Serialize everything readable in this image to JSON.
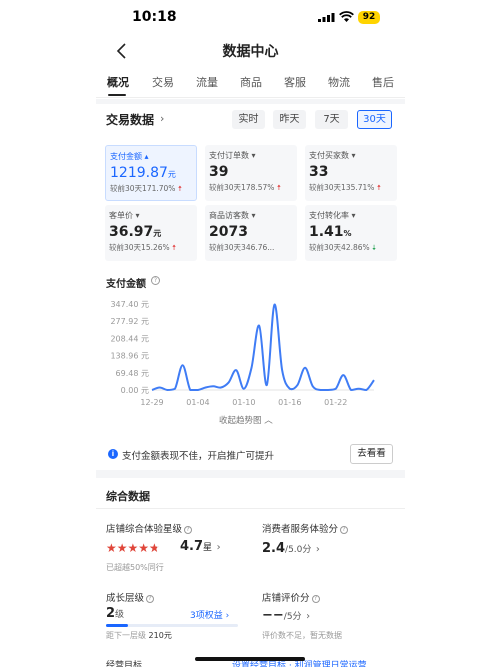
{
  "status": {
    "time": "10:18",
    "battery": "92"
  },
  "nav": {
    "title": "数据中心"
  },
  "tabs": [
    "概况",
    "交易",
    "流量",
    "商品",
    "客服",
    "物流",
    "售后"
  ],
  "trade": {
    "title": "交易数据",
    "ranges": [
      "实时",
      "昨天",
      "7天",
      "30天"
    ],
    "active_range": "30天",
    "cards": [
      {
        "label": "支付金额",
        "value": "1219.87",
        "unit": "元",
        "compare": "较前30天171.70%",
        "trend": "up"
      },
      {
        "label": "支付订单数",
        "value": "39",
        "unit": "",
        "compare": "较前30天178.57%",
        "trend": "up"
      },
      {
        "label": "支付买家数",
        "value": "33",
        "unit": "",
        "compare": "较前30天135.71%",
        "trend": "up"
      },
      {
        "label": "客单价",
        "value": "36.97",
        "unit": "元",
        "compare": "较前30天15.26%",
        "trend": "up"
      },
      {
        "label": "商品访客数",
        "value": "2073",
        "unit": "",
        "compare": "较前30天346.76...",
        "trend": ""
      },
      {
        "label": "支付转化率",
        "value": "1.41",
        "unit": "%",
        "compare": "较前30天42.86%",
        "trend": "down"
      }
    ]
  },
  "chart_data": {
    "type": "line",
    "title": "支付金额",
    "y_ticks": [
      "347.40 元",
      "277.92 元",
      "208.44 元",
      "138.96 元",
      "69.48 元",
      "0.00 元"
    ],
    "x_ticks": [
      "12-29",
      "01-04",
      "01-10",
      "01-16",
      "01-22"
    ],
    "ylim": [
      0,
      347.4
    ],
    "x": [
      0,
      1,
      2,
      3,
      4,
      5,
      6,
      7,
      8,
      9,
      10,
      11,
      12,
      13,
      14,
      15,
      16,
      17,
      18,
      19,
      20,
      21,
      22,
      23,
      24,
      25,
      26,
      27,
      28,
      29
    ],
    "values": [
      0,
      10,
      0,
      5,
      100,
      0,
      0,
      10,
      15,
      10,
      30,
      80,
      5,
      90,
      260,
      20,
      345,
      80,
      5,
      20,
      90,
      15,
      0,
      0,
      5,
      60,
      0,
      5,
      0,
      40
    ],
    "color": "#3f7cf5",
    "grid": false,
    "collapse_label": "收起趋势图"
  },
  "tip": {
    "text": "支付金额表现不佳，开启推广可提升",
    "button": "去看看"
  },
  "composite": {
    "title": "综合数据",
    "store_rating": {
      "label": "店铺综合体验星级",
      "value": "4.7",
      "unit": "星",
      "stars": 4.7,
      "note": "已超越50%同行"
    },
    "service_score": {
      "label": "消费者服务体验分",
      "value": "2.4",
      "unit": "/5.0分"
    },
    "growth": {
      "label": "成长层级",
      "value": "2",
      "unit": "级",
      "benefits": "3项权益",
      "next_label": "距下一层级",
      "next_value": "210元",
      "progress": 0.17
    },
    "review_score": {
      "label": "店铺评价分",
      "value": "−−",
      "unit": "/5分",
      "note": "评价数不足，暂无数据"
    }
  },
  "bottom": {
    "left": "经营目标",
    "right": "设置经营目标 · 利润管理日常运营"
  }
}
